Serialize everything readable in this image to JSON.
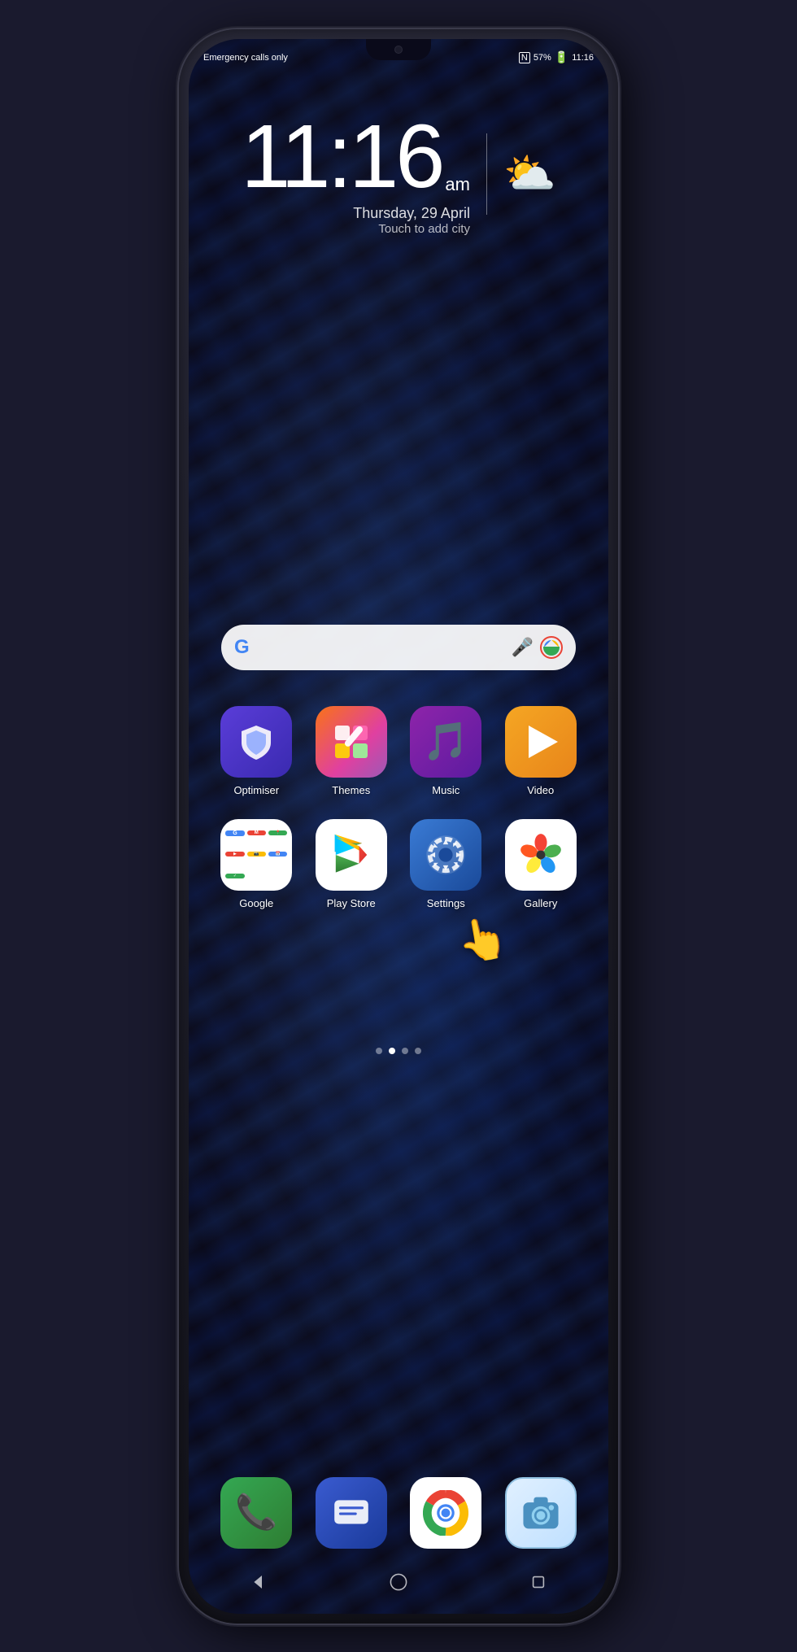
{
  "status_bar": {
    "left": "Emergency calls only",
    "battery": "57%",
    "time": "11:16",
    "nfc": "N"
  },
  "clock": {
    "time": "11:16",
    "am": "am",
    "date": "Thursday, 29 April",
    "city": "Touch to add city"
  },
  "search": {
    "placeholder": ""
  },
  "apps_row1": [
    {
      "id": "optimiser",
      "label": "Optimiser"
    },
    {
      "id": "themes",
      "label": "Themes"
    },
    {
      "id": "music",
      "label": "Music"
    },
    {
      "id": "video",
      "label": "Video"
    }
  ],
  "apps_row2": [
    {
      "id": "google",
      "label": "Google"
    },
    {
      "id": "playstore",
      "label": "Play Store"
    },
    {
      "id": "settings",
      "label": "Settings"
    },
    {
      "id": "gallery",
      "label": "Gallery"
    }
  ],
  "dock": [
    {
      "id": "phone",
      "label": "Phone"
    },
    {
      "id": "messages",
      "label": "Messages"
    },
    {
      "id": "chrome",
      "label": "Chrome"
    },
    {
      "id": "camera",
      "label": "Camera"
    }
  ],
  "nav": {
    "back": "◁",
    "home": "○",
    "recents": "□"
  },
  "page_dots": [
    false,
    true,
    false,
    false
  ]
}
